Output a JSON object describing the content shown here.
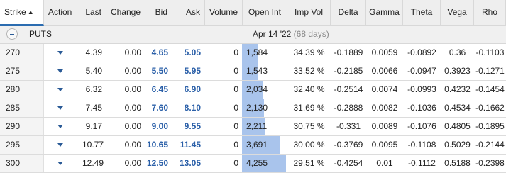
{
  "header": {
    "columns": [
      {
        "key": "strike",
        "label": "Strike",
        "align": "left",
        "sorted": true
      },
      {
        "key": "action",
        "label": "Action",
        "align": "left"
      },
      {
        "key": "last",
        "label": "Last",
        "align": "right"
      },
      {
        "key": "change",
        "label": "Change",
        "align": "right"
      },
      {
        "key": "bid",
        "label": "Bid",
        "align": "right"
      },
      {
        "key": "ask",
        "label": "Ask",
        "align": "right"
      },
      {
        "key": "volume",
        "label": "Volume",
        "align": "right"
      },
      {
        "key": "open_int",
        "label": "Open Int",
        "align": "center"
      },
      {
        "key": "imp_vol",
        "label": "Imp Vol",
        "align": "center"
      },
      {
        "key": "delta",
        "label": "Delta",
        "align": "center"
      },
      {
        "key": "gamma",
        "label": "Gamma",
        "align": "center"
      },
      {
        "key": "theta",
        "label": "Theta",
        "align": "center"
      },
      {
        "key": "vega",
        "label": "Vega",
        "align": "center"
      },
      {
        "key": "rho",
        "label": "Rho",
        "align": "center"
      }
    ],
    "sort_icon": "triangle-up"
  },
  "group": {
    "label": "PUTS",
    "expiry": "Apr 14 '22",
    "days": "(68 days)",
    "collapse_icon": "minus-circle-icon"
  },
  "colors": {
    "quote_text": "#2a5fa8",
    "open_int_bar": "#a9c4ec",
    "header_bg": "#eeeeee",
    "action_arrow": "#2a5a96"
  },
  "rows": [
    {
      "strike": "270",
      "last": "4.39",
      "change": "0.00",
      "bid": "4.65",
      "ask": "5.05",
      "volume": "0",
      "open_int": "1,584",
      "open_int_value": 1584,
      "imp_vol": "34.39 %",
      "delta": "-0.1889",
      "gamma": "0.0059",
      "theta": "-0.0892",
      "vega": "0.36",
      "rho": "-0.1103"
    },
    {
      "strike": "275",
      "last": "5.40",
      "change": "0.00",
      "bid": "5.50",
      "ask": "5.95",
      "volume": "0",
      "open_int": "1,543",
      "open_int_value": 1543,
      "imp_vol": "33.52 %",
      "delta": "-0.2185",
      "gamma": "0.0066",
      "theta": "-0.0947",
      "vega": "0.3923",
      "rho": "-0.1271"
    },
    {
      "strike": "280",
      "last": "6.32",
      "change": "0.00",
      "bid": "6.45",
      "ask": "6.90",
      "volume": "0",
      "open_int": "2,034",
      "open_int_value": 2034,
      "imp_vol": "32.40 %",
      "delta": "-0.2514",
      "gamma": "0.0074",
      "theta": "-0.0993",
      "vega": "0.4232",
      "rho": "-0.1454"
    },
    {
      "strike": "285",
      "last": "7.45",
      "change": "0.00",
      "bid": "7.60",
      "ask": "8.10",
      "volume": "0",
      "open_int": "2,130",
      "open_int_value": 2130,
      "imp_vol": "31.69 %",
      "delta": "-0.2888",
      "gamma": "0.0082",
      "theta": "-0.1036",
      "vega": "0.4534",
      "rho": "-0.1662"
    },
    {
      "strike": "290",
      "last": "9.17",
      "change": "0.00",
      "bid": "9.00",
      "ask": "9.55",
      "volume": "0",
      "open_int": "2,211",
      "open_int_value": 2211,
      "imp_vol": "30.75 %",
      "delta": "-0.331",
      "gamma": "0.0089",
      "theta": "-0.1076",
      "vega": "0.4805",
      "rho": "-0.1895"
    },
    {
      "strike": "295",
      "last": "10.77",
      "change": "0.00",
      "bid": "10.65",
      "ask": "11.45",
      "volume": "0",
      "open_int": "3,691",
      "open_int_value": 3691,
      "imp_vol": "30.00 %",
      "delta": "-0.3769",
      "gamma": "0.0095",
      "theta": "-0.1108",
      "vega": "0.5029",
      "rho": "-0.2144"
    },
    {
      "strike": "300",
      "last": "12.49",
      "change": "0.00",
      "bid": "12.50",
      "ask": "13.05",
      "volume": "0",
      "open_int": "4,255",
      "open_int_value": 4255,
      "imp_vol": "29.51 %",
      "delta": "-0.4254",
      "gamma": "0.01",
      "theta": "-0.1112",
      "vega": "0.5188",
      "rho": "-0.2398"
    }
  ]
}
